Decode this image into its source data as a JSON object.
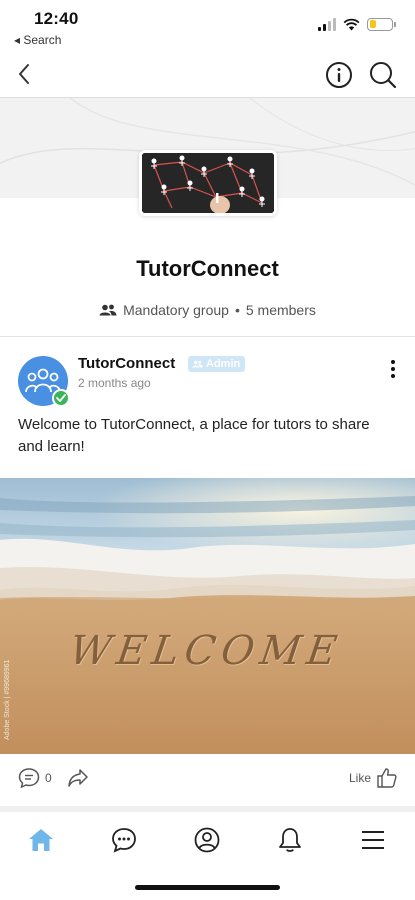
{
  "status_bar": {
    "time": "12:40",
    "back_app": "◂ Search"
  },
  "nav": {
    "back_icon": "chevron-left-icon",
    "info_icon": "info-icon",
    "search_icon": "search-icon"
  },
  "group": {
    "name": "TutorConnect",
    "type": "Mandatory group",
    "separator": "•",
    "members": "5 members"
  },
  "post": {
    "author": "TutorConnect",
    "badge": "Admin",
    "time_ago": "2 months ago",
    "text": "Welcome to TutorConnect, a place for tutors to share and learn!",
    "image_caption": "WELCOME",
    "watermark": "Adobe Stock | #99689961",
    "comment_count": "0",
    "like_label": "Like"
  },
  "tabbar": {
    "items": [
      "home-icon",
      "chat-icon",
      "profile-icon",
      "bell-icon",
      "menu-icon"
    ],
    "active_color": "#6fb7e8"
  },
  "colors": {
    "accent": "#4a90e2",
    "badge_bg": "#cfe6f7",
    "verified": "#3cb45a"
  }
}
